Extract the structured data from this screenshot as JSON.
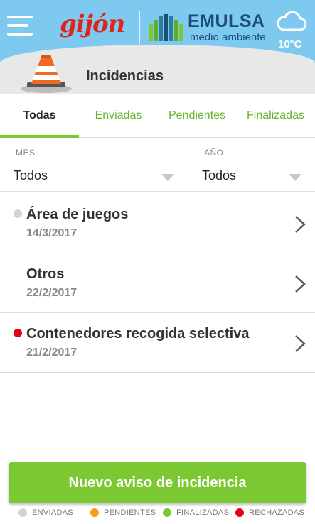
{
  "header": {
    "logo_left": "gijón",
    "logo_right_name": "EMULSA",
    "logo_right_tagline": "medio ambiente",
    "temperature": "10°C",
    "menu_icon": "hamburger-menu-icon",
    "weather_icon": "cloud-icon"
  },
  "page": {
    "title": "Incidencias",
    "title_icon": "traffic-cone-icon"
  },
  "tabs": [
    {
      "label": "Todas",
      "active": true
    },
    {
      "label": "Enviadas",
      "active": false
    },
    {
      "label": "Pendientes",
      "active": false
    },
    {
      "label": "Finalizadas",
      "active": false
    }
  ],
  "filters": {
    "month": {
      "label": "MES",
      "value": "Todos"
    },
    "year": {
      "label": "AÑO",
      "value": "Todos"
    }
  },
  "incidents": [
    {
      "title": "Área de juegos",
      "date": "14/3/2017",
      "status_color": "#d3d3d3"
    },
    {
      "title": "Otros",
      "date": "22/2/2017",
      "status_color": ""
    },
    {
      "title": "Contenedores recogida selectiva",
      "date": "21/2/2017",
      "status_color": "#e5001b"
    }
  ],
  "actions": {
    "new_incident": "Nuevo aviso de incidencia"
  },
  "legend": [
    {
      "label": "ENVIADAS",
      "color": "#d3d3d3"
    },
    {
      "label": "PENDIENTES",
      "color": "#f59c1a"
    },
    {
      "label": "FINALIZADAS",
      "color": "#7cc832"
    },
    {
      "label": "RECHAZADAS",
      "color": "#e5001b"
    }
  ],
  "colors": {
    "header_bg": "#7ec9ef",
    "accent_green": "#7cc832",
    "brand_red": "#e2231a",
    "brand_blue": "#1d4f76"
  }
}
